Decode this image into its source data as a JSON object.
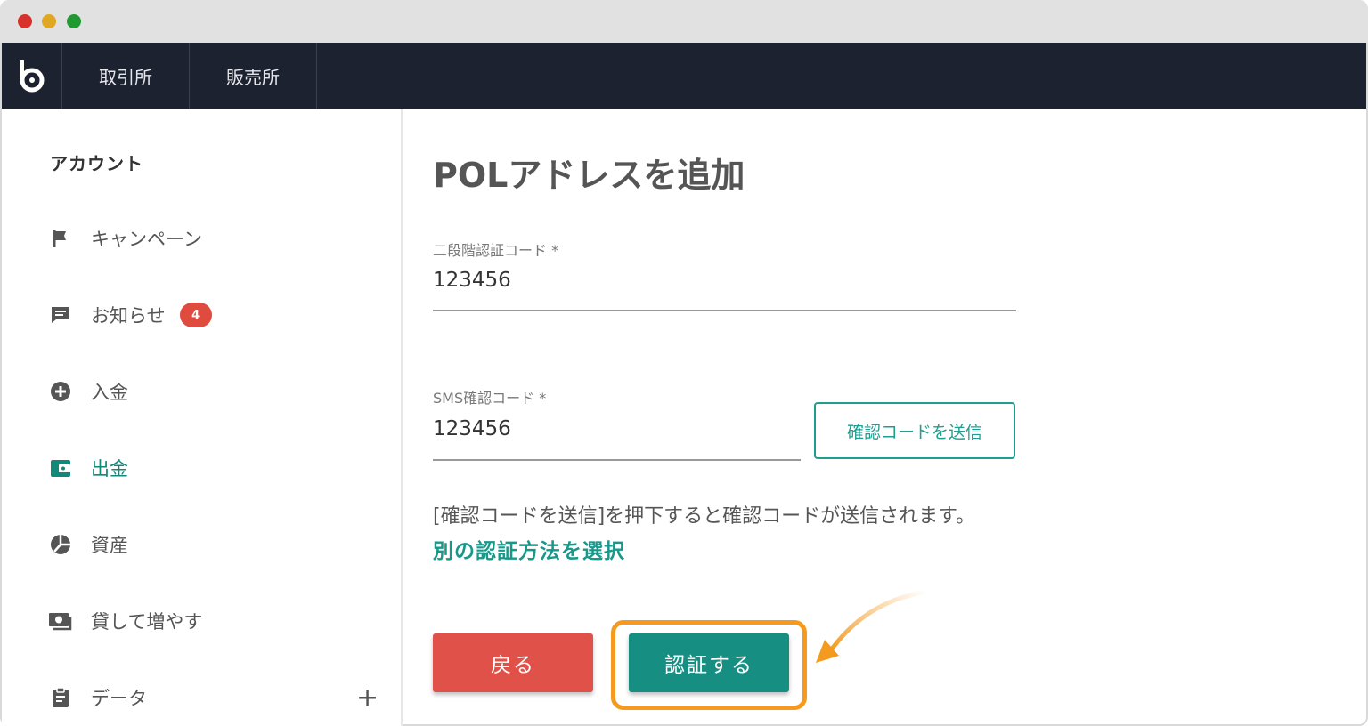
{
  "header": {
    "tabs": [
      {
        "label": "取引所"
      },
      {
        "label": "販売所"
      }
    ]
  },
  "sidebar": {
    "title": "アカウント",
    "items": [
      {
        "label": "キャンペーン",
        "icon": "flag-icon"
      },
      {
        "label": "お知らせ",
        "icon": "message-icon",
        "badge": "4"
      },
      {
        "label": "入金",
        "icon": "plus-circle-icon"
      },
      {
        "label": "出金",
        "icon": "wallet-icon",
        "active": true
      },
      {
        "label": "資産",
        "icon": "pie-chart-icon"
      },
      {
        "label": "貸して増やす",
        "icon": "money-icon"
      },
      {
        "label": "データ",
        "icon": "clipboard-icon"
      }
    ]
  },
  "main": {
    "title": "POLアドレスを追加",
    "two_factor": {
      "label": "二段階認証コード *",
      "value": "123456"
    },
    "sms": {
      "label": "SMS確認コード *",
      "value": "123456",
      "send_button": "確認コードを送信"
    },
    "info_text": "[確認コードを送信]を押下すると確認コードが送信されます。",
    "alt_link": "別の認証方法を選択",
    "back_button": "戻る",
    "auth_button": "認証する"
  },
  "colors": {
    "accent": "#168f82",
    "danger": "#df5149",
    "highlight": "#f39a1f",
    "header_bg": "#1c2230"
  }
}
